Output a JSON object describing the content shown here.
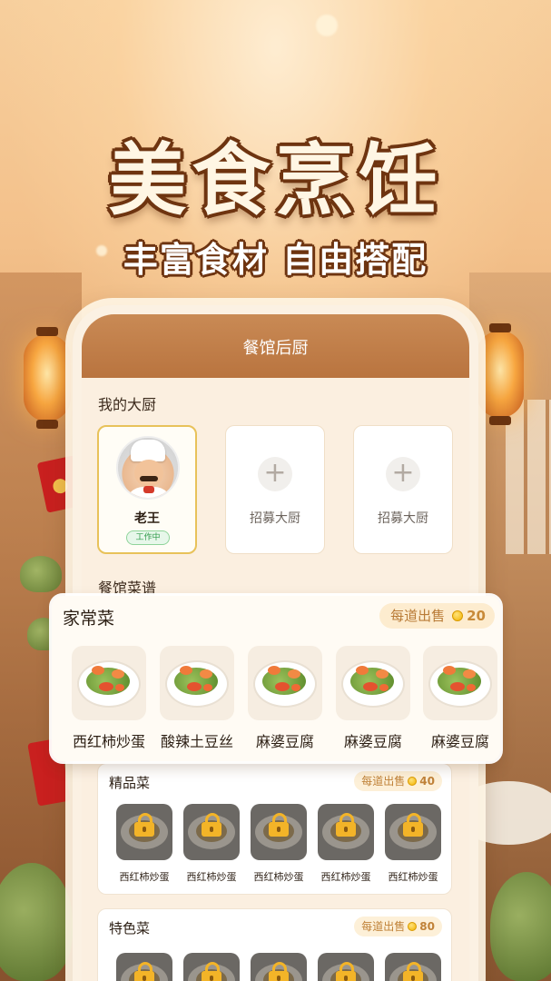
{
  "headline": {
    "title": "美食烹饪",
    "subtitle": "丰富食材 自由搭配"
  },
  "phone": {
    "header_title": "餐馆后厨",
    "my_chefs_label": "我的大厨",
    "chefs": [
      {
        "name": "老王",
        "status": "工作中",
        "hired": true
      },
      {
        "label": "招募大厨",
        "hired": false
      },
      {
        "label": "招募大厨",
        "hired": false
      }
    ],
    "menu_label": "餐馆菜谱"
  },
  "categories": {
    "home": {
      "title": "家常菜",
      "price_label": "每道出售",
      "price": "20",
      "dishes": [
        "西红柿炒蛋",
        "酸辣土豆丝",
        "麻婆豆腐",
        "麻婆豆腐",
        "麻婆豆腐"
      ]
    },
    "premium": {
      "title": "精品菜",
      "price_label": "每道出售",
      "price": "40",
      "dishes": [
        "西红柿炒蛋",
        "西红柿炒蛋",
        "西红柿炒蛋",
        "西红柿炒蛋",
        "西红柿炒蛋"
      ],
      "locked": true
    },
    "special": {
      "title": "特色菜",
      "price_label": "每道出售",
      "price": "80",
      "locked": true
    }
  },
  "colors": {
    "header_brown": "#c98a55",
    "title_outline": "#6e3410",
    "coin_gold": "#f2b300",
    "active_border": "#e8c25a",
    "status_green": "#2d9a48"
  },
  "icons": {
    "add": "plus-icon",
    "coin": "coin-icon",
    "lock": "lock-icon"
  }
}
